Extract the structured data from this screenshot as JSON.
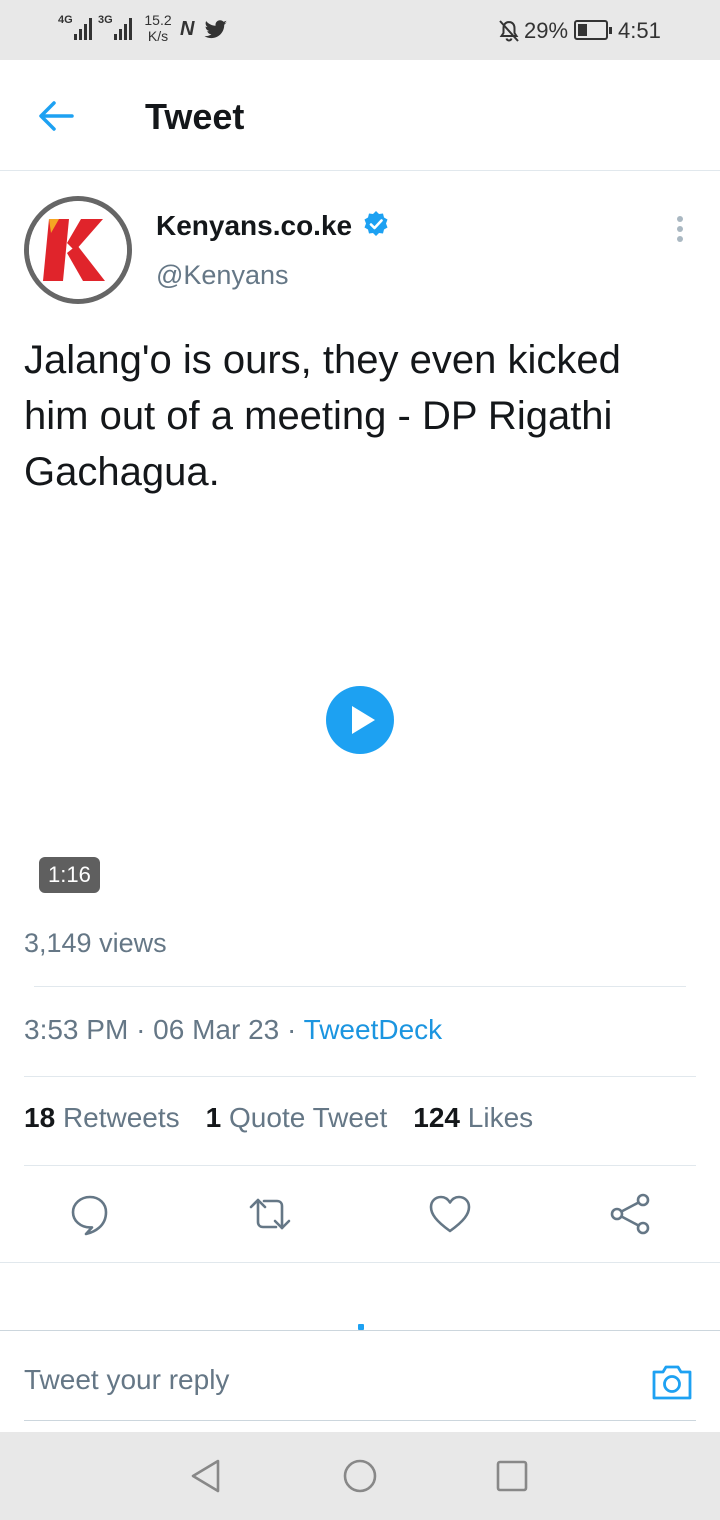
{
  "status_bar": {
    "network1": "4G",
    "network2": "3G",
    "speed_value": "15.2",
    "speed_unit": "K/s",
    "battery_percent": "29%",
    "time": "4:51"
  },
  "header": {
    "back_icon": "arrow-left-icon",
    "title": "Tweet"
  },
  "tweet": {
    "author_name": "Kenyans.co.ke",
    "author_handle": "@Kenyans",
    "verified": true,
    "text": "Jalang'o is ours, they even kicked him out of a meeting - DP Rigathi Gachagua.",
    "video_duration": "1:16",
    "views": "3,149 views",
    "time": "3:53 PM",
    "date": "06 Mar 23",
    "source": "TweetDeck",
    "separator": "·"
  },
  "stats": {
    "retweets_count": "18",
    "retweets_label": "Retweets",
    "quotes_count": "1",
    "quotes_label": "Quote Tweet",
    "likes_count": "124",
    "likes_label": "Likes"
  },
  "actions": [
    "reply-icon",
    "retweet-icon",
    "like-icon",
    "share-icon"
  ],
  "reply_bar": {
    "placeholder": "Tweet your reply",
    "camera_icon": "camera-icon"
  },
  "colors": {
    "accent": "#1da1f2",
    "link": "#1b95e0",
    "secondary_text": "#657786",
    "logo_red": "#e0242b",
    "logo_orange": "#f5a623"
  }
}
